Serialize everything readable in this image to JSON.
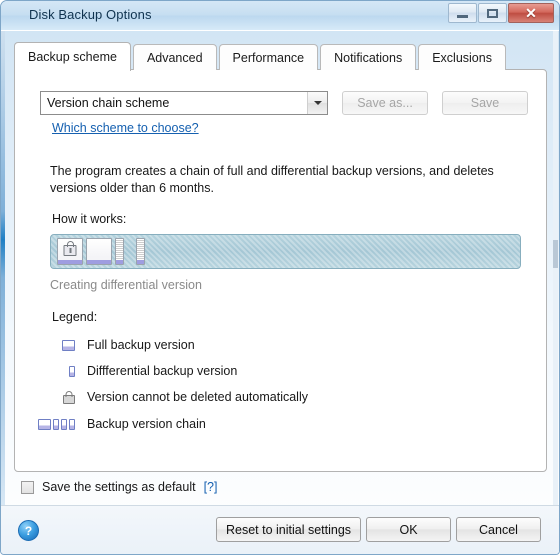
{
  "window": {
    "title": "Disk Backup Options",
    "controls": {
      "minimize": "minimize-button",
      "maximize": "maximize-button",
      "close": "✕"
    }
  },
  "tabs": [
    {
      "label": "Backup scheme",
      "active": true
    },
    {
      "label": "Advanced",
      "active": false
    },
    {
      "label": "Performance",
      "active": false
    },
    {
      "label": "Notifications",
      "active": false
    },
    {
      "label": "Exclusions",
      "active": false
    }
  ],
  "scheme": {
    "selected": "Version chain scheme",
    "options": [
      "Version chain scheme"
    ],
    "save_as_label": "Save as...",
    "save_label": "Save",
    "help_link": "Which scheme to choose?"
  },
  "description": "The program creates a chain of full and differential backup versions, and deletes versions older than 6 months.",
  "how_it_works": {
    "label": "How it works:",
    "status": "Creating differential version",
    "items": [
      {
        "type": "full",
        "locked": true
      },
      {
        "type": "full",
        "locked": false
      },
      {
        "type": "diff"
      },
      {
        "type": "gap"
      },
      {
        "type": "diff"
      }
    ]
  },
  "legend": {
    "title": "Legend:",
    "entries": [
      {
        "icon": "full-version-icon",
        "label": "Full backup version"
      },
      {
        "icon": "differential-version-icon",
        "label": "Diffferential backup version"
      },
      {
        "icon": "lock-icon",
        "label": "Version cannot be deleted automatically"
      },
      {
        "icon": "version-chain-icon",
        "label": "Backup version chain"
      }
    ]
  },
  "save_default": {
    "label": "Save the settings as default",
    "help": "[?]",
    "checked": false
  },
  "footer": {
    "help_icon": "?",
    "reset_label": "Reset to initial settings",
    "ok_label": "OK",
    "cancel_label": "Cancel"
  },
  "colors": {
    "link": "#1560b0",
    "titlebar": "#c6def1",
    "close_button": "#c0514a",
    "diagram_bg": "#a5c7d5",
    "version_accent": "#9f9de0"
  }
}
